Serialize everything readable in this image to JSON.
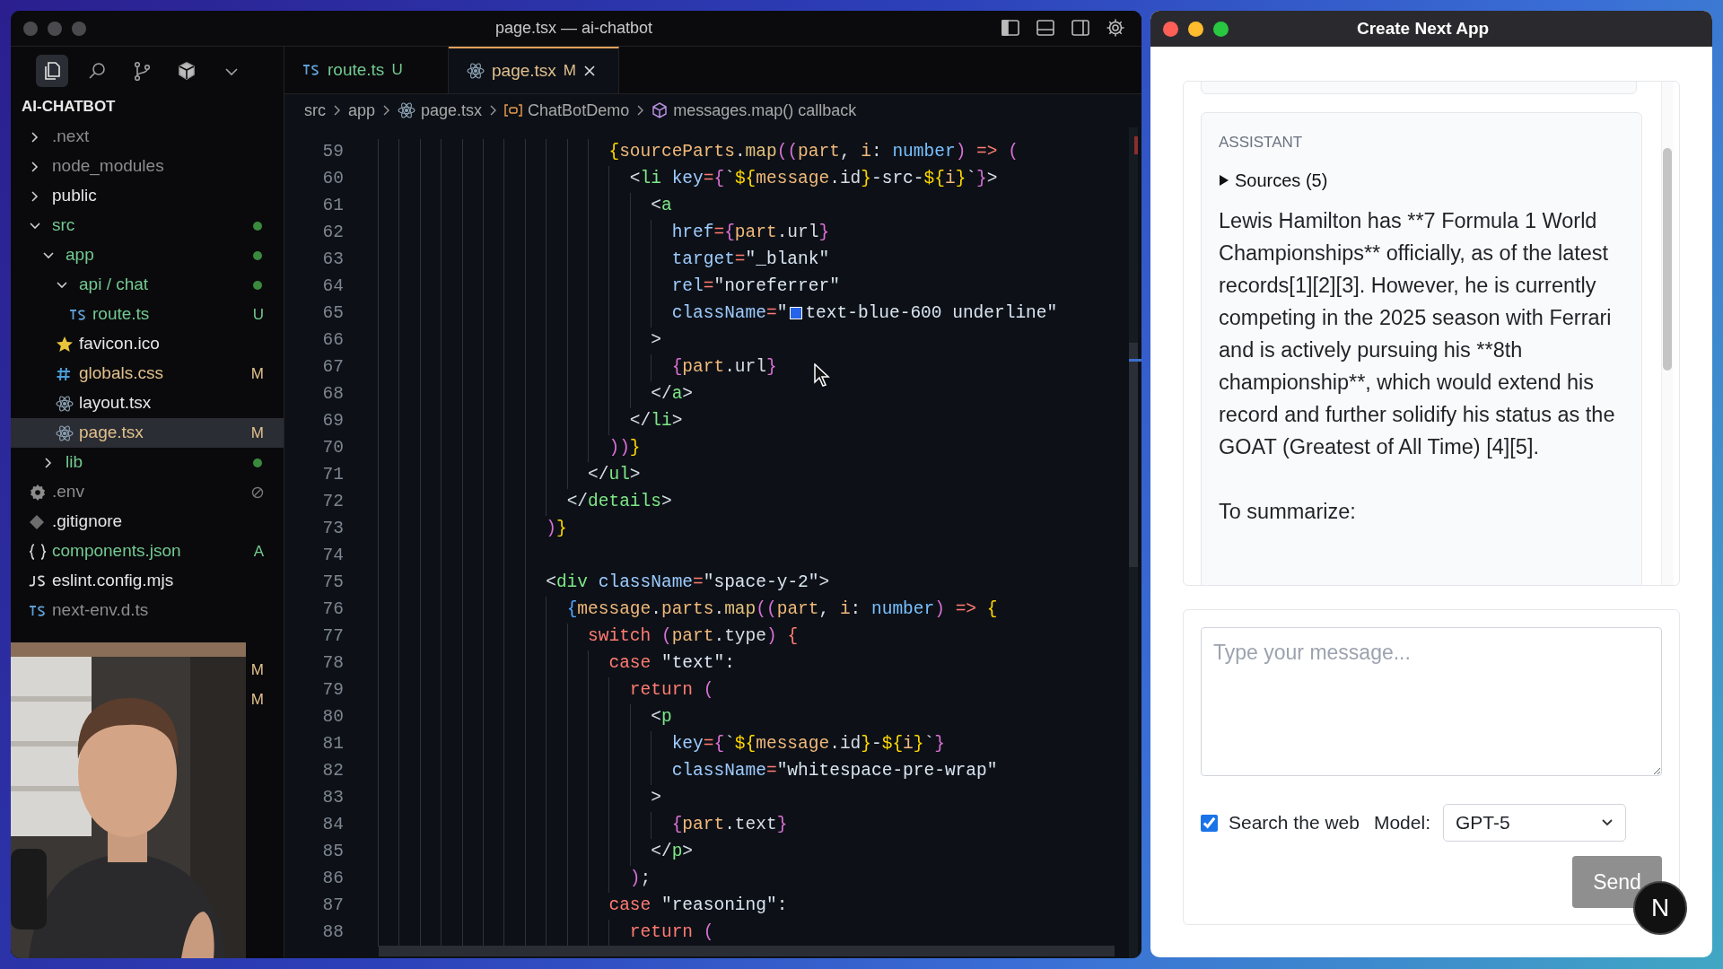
{
  "vscode": {
    "title": "page.tsx — ai-chatbot",
    "activity_bar": [
      {
        "kind": "files",
        "selected": true
      },
      {
        "kind": "search",
        "selected": false
      },
      {
        "kind": "source-control",
        "selected": false
      },
      {
        "kind": "extensions",
        "selected": false
      },
      {
        "kind": "more",
        "selected": false
      }
    ],
    "explorer": {
      "title": "AI-CHATBOT",
      "items": [
        {
          "kind": "folder",
          "label": ".next",
          "color": "#8c8c8c",
          "expanded": false,
          "dot": false
        },
        {
          "kind": "folder",
          "label": "node_modules",
          "color": "#8c8c8c",
          "expanded": false,
          "dot": false
        },
        {
          "kind": "folder",
          "label": "public",
          "color": "#e6e6e6",
          "expanded": false,
          "dot": false
        },
        {
          "kind": "folder",
          "label": "src",
          "color": "#73c991",
          "expanded": true,
          "dot": true,
          "children": [
            {
              "kind": "folder",
              "label": "app",
              "color": "#73c991",
              "expanded": true,
              "dot": true,
              "children": [
                {
                  "kind": "folder",
                  "label": "api / chat",
                  "color": "#73c991",
                  "expanded": true,
                  "dot": true,
                  "children": [
                    {
                      "kind": "ts",
                      "label": "route.ts",
                      "color": "#73c991",
                      "badge": "U",
                      "selected": false
                    }
                  ]
                },
                {
                  "kind": "star",
                  "label": "favicon.ico",
                  "color": "#e6e6e6",
                  "selected": false
                },
                {
                  "kind": "hash",
                  "label": "globals.css",
                  "color": "#e2c08d",
                  "badge": "M",
                  "selected": false
                },
                {
                  "kind": "react",
                  "label": "layout.tsx",
                  "color": "#e6e6e6",
                  "selected": false
                },
                {
                  "kind": "react",
                  "label": "page.tsx",
                  "color": "#e2c08d",
                  "badge": "M",
                  "selected": true
                }
              ]
            },
            {
              "kind": "folder",
              "label": "lib",
              "color": "#73c991",
              "expanded": false,
              "dot": true
            }
          ]
        },
        {
          "kind": "gear",
          "label": ".env",
          "color": "#8c8c8c",
          "ignored_mark": true,
          "selected": false
        },
        {
          "kind": "git",
          "label": ".gitignore",
          "color": "#e6e6e6",
          "ignored_mark": false,
          "selected": false
        },
        {
          "kind": "braces",
          "label": "components.json",
          "color": "#73c991",
          "badge": "A",
          "selected": false
        },
        {
          "kind": "js",
          "label": "eslint.config.mjs",
          "color": "#e6e6e6",
          "selected": false
        },
        {
          "kind": "ts",
          "label": "next-env.d.ts",
          "color": "#8c8c8c",
          "selected": false
        }
      ],
      "covered_badges": [
        "M",
        "M"
      ]
    },
    "tabs": [
      {
        "kind": "ts",
        "label": "route.ts",
        "badge": "U",
        "color": "#73c991",
        "selected": false
      },
      {
        "kind": "react",
        "label": "page.tsx",
        "badge": "M",
        "color": "#e2c08d",
        "selected": true
      }
    ],
    "breadcrumb": [
      {
        "label": "src"
      },
      {
        "label": "app"
      },
      {
        "kind": "react",
        "label": "page.tsx"
      },
      {
        "kind": "variable",
        "label": "ChatBotDemo"
      },
      {
        "kind": "cube",
        "label": "messages.map() callback"
      }
    ],
    "code_lines": [
      {
        "number": "59",
        "tokens": [
          {
            "text": "                      {",
            "kind": "b1"
          },
          {
            "text": "sourceParts",
            "kind": "var"
          },
          {
            "text": ".",
            "kind": "punc"
          },
          {
            "text": "map",
            "kind": "fn"
          },
          {
            "text": "((",
            "kind": "b2"
          },
          {
            "text": "part",
            "kind": "var"
          },
          {
            "text": ", ",
            "kind": "punc"
          },
          {
            "text": "i",
            "kind": "var"
          },
          {
            "text": ": ",
            "kind": "punc"
          },
          {
            "text": "number",
            "kind": "type"
          },
          {
            "text": ")",
            "kind": "b2"
          },
          {
            "text": " => ",
            "kind": "kw"
          },
          {
            "text": "(",
            "kind": "b2"
          }
        ]
      },
      {
        "number": "60",
        "tokens": [
          {
            "text": "                        <",
            "kind": "punc"
          },
          {
            "text": "li",
            "kind": "tag"
          },
          {
            "text": " key",
            "kind": "attr"
          },
          {
            "text": "=",
            "kind": "kw"
          },
          {
            "text": "{",
            "kind": "b2"
          },
          {
            "text": "`",
            "kind": "str"
          },
          {
            "text": "${",
            "kind": "b1"
          },
          {
            "text": "message",
            "kind": "var"
          },
          {
            "text": ".id",
            "kind": "punc"
          },
          {
            "text": "}",
            "kind": "b1"
          },
          {
            "text": "-src-",
            "kind": "str"
          },
          {
            "text": "${",
            "kind": "b1"
          },
          {
            "text": "i",
            "kind": "var"
          },
          {
            "text": "}",
            "kind": "b1"
          },
          {
            "text": "`",
            "kind": "str"
          },
          {
            "text": "}",
            "kind": "b2"
          },
          {
            "text": ">",
            "kind": "punc"
          }
        ]
      },
      {
        "number": "61",
        "tokens": [
          {
            "text": "                          <",
            "kind": "punc"
          },
          {
            "text": "a",
            "kind": "tag"
          }
        ]
      },
      {
        "number": "62",
        "tokens": [
          {
            "text": "                            href",
            "kind": "attr"
          },
          {
            "text": "=",
            "kind": "kw"
          },
          {
            "text": "{",
            "kind": "b2"
          },
          {
            "text": "part",
            "kind": "var"
          },
          {
            "text": ".url",
            "kind": "punc"
          },
          {
            "text": "}",
            "kind": "b2"
          }
        ]
      },
      {
        "number": "63",
        "tokens": [
          {
            "text": "                            target",
            "kind": "attr"
          },
          {
            "text": "=",
            "kind": "kw"
          },
          {
            "text": "\"_blank\"",
            "kind": "str"
          }
        ]
      },
      {
        "number": "64",
        "tokens": [
          {
            "text": "                            rel",
            "kind": "attr"
          },
          {
            "text": "=",
            "kind": "kw"
          },
          {
            "text": "\"noreferrer\"",
            "kind": "str"
          }
        ]
      },
      {
        "number": "65",
        "tokens": [
          {
            "text": "                            className",
            "kind": "attr"
          },
          {
            "text": "=",
            "kind": "kw"
          },
          {
            "text": "\"",
            "kind": "str"
          },
          {
            "kind": "swatch",
            "color": "#2563eb"
          },
          {
            "text": "text-blue-600 underline\"",
            "kind": "str"
          }
        ]
      },
      {
        "number": "66",
        "tokens": [
          {
            "text": "                          >",
            "kind": "punc"
          }
        ]
      },
      {
        "number": "67",
        "tokens": [
          {
            "text": "                            {",
            "kind": "b2"
          },
          {
            "text": "part",
            "kind": "var"
          },
          {
            "text": ".url",
            "kind": "punc"
          },
          {
            "text": "}",
            "kind": "b2"
          }
        ]
      },
      {
        "number": "68",
        "tokens": [
          {
            "text": "                          </",
            "kind": "punc"
          },
          {
            "text": "a",
            "kind": "tag"
          },
          {
            "text": ">",
            "kind": "punc"
          }
        ]
      },
      {
        "number": "69",
        "tokens": [
          {
            "text": "                        </",
            "kind": "punc"
          },
          {
            "text": "li",
            "kind": "tag"
          },
          {
            "text": ">",
            "kind": "punc"
          }
        ]
      },
      {
        "number": "70",
        "tokens": [
          {
            "text": "                      ))",
            "kind": "b2"
          },
          {
            "text": "}",
            "kind": "b1"
          }
        ]
      },
      {
        "number": "71",
        "tokens": [
          {
            "text": "                    </",
            "kind": "punc"
          },
          {
            "text": "ul",
            "kind": "tag"
          },
          {
            "text": ">",
            "kind": "punc"
          }
        ]
      },
      {
        "number": "72",
        "tokens": [
          {
            "text": "                  </",
            "kind": "punc"
          },
          {
            "text": "details",
            "kind": "tag"
          },
          {
            "text": ">",
            "kind": "punc"
          }
        ]
      },
      {
        "number": "73",
        "tokens": [
          {
            "text": "                )",
            "kind": "b2"
          },
          {
            "text": "}",
            "kind": "b1"
          }
        ]
      },
      {
        "number": "74"
      },
      {
        "number": "75",
        "tokens": [
          {
            "text": "                <",
            "kind": "punc"
          },
          {
            "text": "div",
            "kind": "tag"
          },
          {
            "text": " className",
            "kind": "attr"
          },
          {
            "text": "=",
            "kind": "kw"
          },
          {
            "text": "\"space-y-2\"",
            "kind": "str"
          },
          {
            "text": ">",
            "kind": "punc"
          }
        ]
      },
      {
        "number": "76",
        "tokens": [
          {
            "text": "                  {",
            "kind": "b3"
          },
          {
            "text": "message",
            "kind": "var"
          },
          {
            "text": ".",
            "kind": "punc"
          },
          {
            "text": "parts",
            "kind": "var"
          },
          {
            "text": ".",
            "kind": "punc"
          },
          {
            "text": "map",
            "kind": "fn"
          },
          {
            "text": "((",
            "kind": "b2"
          },
          {
            "text": "part",
            "kind": "var"
          },
          {
            "text": ", ",
            "kind": "punc"
          },
          {
            "text": "i",
            "kind": "var"
          },
          {
            "text": ": ",
            "kind": "punc"
          },
          {
            "text": "number",
            "kind": "type"
          },
          {
            "text": ")",
            "kind": "b2"
          },
          {
            "text": " => ",
            "kind": "kw"
          },
          {
            "text": "{",
            "kind": "b1"
          }
        ]
      },
      {
        "number": "77",
        "tokens": [
          {
            "text": "                    switch",
            "kind": "kw"
          },
          {
            "text": " (",
            "kind": "b2"
          },
          {
            "text": "part",
            "kind": "var"
          },
          {
            "text": ".type",
            "kind": "punc"
          },
          {
            "text": ")",
            "kind": "b2"
          },
          {
            "text": " {",
            "kind": "kw"
          }
        ]
      },
      {
        "number": "78",
        "tokens": [
          {
            "text": "                      case",
            "kind": "kw"
          },
          {
            "text": " \"text\"",
            "kind": "str"
          },
          {
            "text": ":",
            "kind": "punc"
          }
        ]
      },
      {
        "number": "79",
        "tokens": [
          {
            "text": "                        return",
            "kind": "kw"
          },
          {
            "text": " (",
            "kind": "b2"
          }
        ]
      },
      {
        "number": "80",
        "tokens": [
          {
            "text": "                          <",
            "kind": "punc"
          },
          {
            "text": "p",
            "kind": "tag"
          }
        ]
      },
      {
        "number": "81",
        "tokens": [
          {
            "text": "                            key",
            "kind": "attr"
          },
          {
            "text": "=",
            "kind": "kw"
          },
          {
            "text": "{",
            "kind": "b2"
          },
          {
            "text": "`",
            "kind": "str"
          },
          {
            "text": "${",
            "kind": "b1"
          },
          {
            "text": "message",
            "kind": "var"
          },
          {
            "text": ".id",
            "kind": "punc"
          },
          {
            "text": "}",
            "kind": "b1"
          },
          {
            "text": "-",
            "kind": "str"
          },
          {
            "text": "${",
            "kind": "b1"
          },
          {
            "text": "i",
            "kind": "var"
          },
          {
            "text": "}",
            "kind": "b1"
          },
          {
            "text": "`",
            "kind": "str"
          },
          {
            "text": "}",
            "kind": "b2"
          }
        ]
      },
      {
        "number": "82",
        "tokens": [
          {
            "text": "                            className",
            "kind": "attr"
          },
          {
            "text": "=",
            "kind": "kw"
          },
          {
            "text": "\"whitespace-pre-wrap\"",
            "kind": "str"
          }
        ]
      },
      {
        "number": "83",
        "tokens": [
          {
            "text": "                          >",
            "kind": "punc"
          }
        ]
      },
      {
        "number": "84",
        "tokens": [
          {
            "text": "                            {",
            "kind": "b2"
          },
          {
            "text": "part",
            "kind": "var"
          },
          {
            "text": ".text",
            "kind": "punc"
          },
          {
            "text": "}",
            "kind": "b2"
          }
        ]
      },
      {
        "number": "85",
        "tokens": [
          {
            "text": "                          </",
            "kind": "punc"
          },
          {
            "text": "p",
            "kind": "tag"
          },
          {
            "text": ">",
            "kind": "punc"
          }
        ]
      },
      {
        "number": "86",
        "tokens": [
          {
            "text": "                        )",
            "kind": "b2"
          },
          {
            "text": ";",
            "kind": "punc"
          }
        ]
      },
      {
        "number": "87",
        "tokens": [
          {
            "text": "                      case",
            "kind": "kw"
          },
          {
            "text": " \"reasoning\"",
            "kind": "str"
          },
          {
            "text": ":",
            "kind": "punc"
          }
        ]
      },
      {
        "number": "88",
        "tokens": [
          {
            "text": "                        return",
            "kind": "kw"
          },
          {
            "text": " (",
            "kind": "b2"
          }
        ]
      }
    ]
  },
  "chat_app": {
    "title": "Create Next App",
    "message": {
      "role": "ASSISTANT",
      "sources": {
        "label": "Sources (5)",
        "expanded": false
      },
      "paragraphs": [
        "Lewis Hamilton has **7 Formula 1 World Championships** officially, as of the latest records[1][2][3]. However, he is currently competing in the 2025 season with Ferrari and is actively pursuing his **8th championship**, which would extend his record and further solidify his status as the GOAT (Greatest of All Time) [4][5].",
        "To summarize:"
      ]
    },
    "composer": {
      "placeholder": "Type your message...",
      "search_web": {
        "label": "Search the web",
        "checked": true
      },
      "model_label": "Model:",
      "model": "GPT-5",
      "send": {
        "label": "Send",
        "disabled": true
      }
    },
    "dev_indicator": "N"
  }
}
